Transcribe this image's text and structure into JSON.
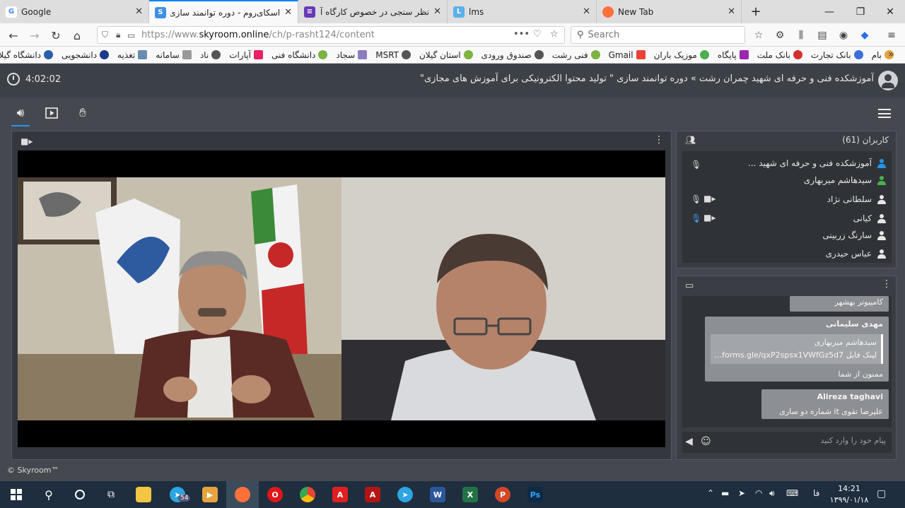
{
  "browser": {
    "tabs": [
      {
        "label": "Google",
        "icon": "google-icon",
        "color": "#4285f4",
        "active": false
      },
      {
        "label": "اسکای‌روم - دوره توانمند سازی",
        "icon": "skyroom-icon",
        "color": "#3d8ee6",
        "active": true
      },
      {
        "label": "نظر سنجی در خصوص کارگاه آمو",
        "icon": "forms-icon",
        "color": "#673ab7",
        "active": false
      },
      {
        "label": "lms",
        "icon": "lms-icon",
        "color": "#5ab0e8",
        "active": false
      },
      {
        "label": "New Tab",
        "icon": "firefox-icon",
        "color": "#ff7139",
        "active": false
      }
    ],
    "url_prefix": "https://www.",
    "url_domain": "skyroom.online",
    "url_path": "/ch/p-rasht124/content",
    "search_placeholder": "Search",
    "bookmarks": [
      "بام",
      "بانک تجارت",
      "بانک ملت",
      "پایگاه",
      "موزیک باران",
      "Gmail",
      "فنی رشت",
      "صندوق ورودی",
      "استان گیلان",
      "MSRT",
      "سجاد",
      "دانشگاه فنی",
      "آپارات",
      "ناد",
      "سامانه",
      "تغذیه",
      "دانشجویی",
      "دانشگاه گیلان"
    ]
  },
  "room": {
    "title": "آموزشکده فنی و حرفه ای شهید چمران رشت » دوره توانمند سازی \" تولید محتوا الکترونیکی برای آموزش های مجازی\"",
    "timer": "4:02:02",
    "footer": "© Skyroom™"
  },
  "users": {
    "title": "کاربران (61)",
    "list": [
      {
        "name": "آموزشکده فنی و حرفه ای شهید ...",
        "color": "#2196f3",
        "mic": true,
        "cam": false
      },
      {
        "name": "سیدهاشم میربهاری",
        "color": "#4caf50",
        "mic": false,
        "cam": false
      },
      {
        "name": "سلطانی نژاد",
        "color": "#e6e6e6",
        "mic": true,
        "cam": true
      },
      {
        "name": "کیانی",
        "color": "#e6e6e6",
        "mic": true,
        "cam": true,
        "mic_active": true
      },
      {
        "name": "سارنگ زربینی",
        "color": "#e6e6e6",
        "mic": false,
        "cam": false
      },
      {
        "name": "عباس حیدری",
        "color": "#e6e6e6",
        "mic": false,
        "cam": false
      }
    ]
  },
  "chat": {
    "messages": [
      {
        "text": "کامپیوتر بهشهر"
      },
      {
        "name": "مهدی سلیمانی",
        "quote_name": "سیدهاشم میربهاری",
        "quote_text": "لینک فایل forms.gle/qxP2spsx1VWfGz5d7...",
        "text": "ممنون از شما"
      },
      {
        "name": "Alireza taghavi",
        "text": "علیرضا تقوی it شماره دو ساری"
      }
    ],
    "input_placeholder": "پیام خود را وارد کنید"
  },
  "taskbar": {
    "apps": [
      {
        "name": "file-explorer",
        "color": "#f4c542"
      },
      {
        "name": "telegram",
        "color": "#2ca5e0",
        "badge": "54"
      },
      {
        "name": "media-player",
        "color": "#e8a33d"
      },
      {
        "name": "firefox",
        "color": "#ff7139"
      },
      {
        "name": "opera",
        "color": "#e0161b"
      },
      {
        "name": "chrome",
        "color": "#34a853"
      },
      {
        "name": "acrobat",
        "color": "#e02020"
      },
      {
        "name": "acrobat-dc",
        "color": "#b51414"
      },
      {
        "name": "telegram-2",
        "color": "#2ca5e0"
      },
      {
        "name": "word",
        "color": "#2b579a"
      },
      {
        "name": "excel",
        "color": "#217346"
      },
      {
        "name": "powerpoint",
        "color": "#d24726"
      },
      {
        "name": "photoshop",
        "color": "#0d2b44"
      }
    ],
    "lang": "فا",
    "time": "14:21",
    "date": "۱۳۹۹/۰۱/۱۸"
  }
}
